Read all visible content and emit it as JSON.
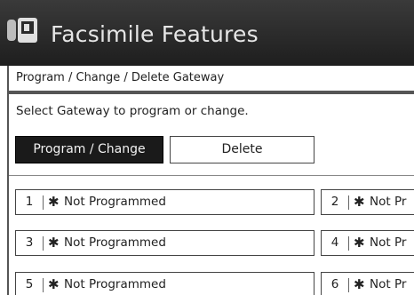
{
  "header": {
    "title": "Facsimile Features",
    "icon": "fax-machine-icon"
  },
  "breadcrumb": "Program / Change / Delete Gateway",
  "instruction": "Select Gateway to program or change.",
  "buttons": {
    "program_change": "Program / Change",
    "delete": "Delete"
  },
  "gateways": [
    {
      "number": "1",
      "mark": "✱",
      "status": "Not Programmed"
    },
    {
      "number": "2",
      "mark": "✱",
      "status": "Not Pr"
    },
    {
      "number": "3",
      "mark": "✱",
      "status": "Not Programmed"
    },
    {
      "number": "4",
      "mark": "✱",
      "status": "Not Pr"
    },
    {
      "number": "5",
      "mark": "✱",
      "status": "Not Programmed"
    },
    {
      "number": "6",
      "mark": "✱",
      "status": "Not Pr"
    }
  ],
  "colors": {
    "header_bg": "#2a2a2a",
    "selected_button_bg": "#1a1a1a",
    "border": "#444444"
  }
}
